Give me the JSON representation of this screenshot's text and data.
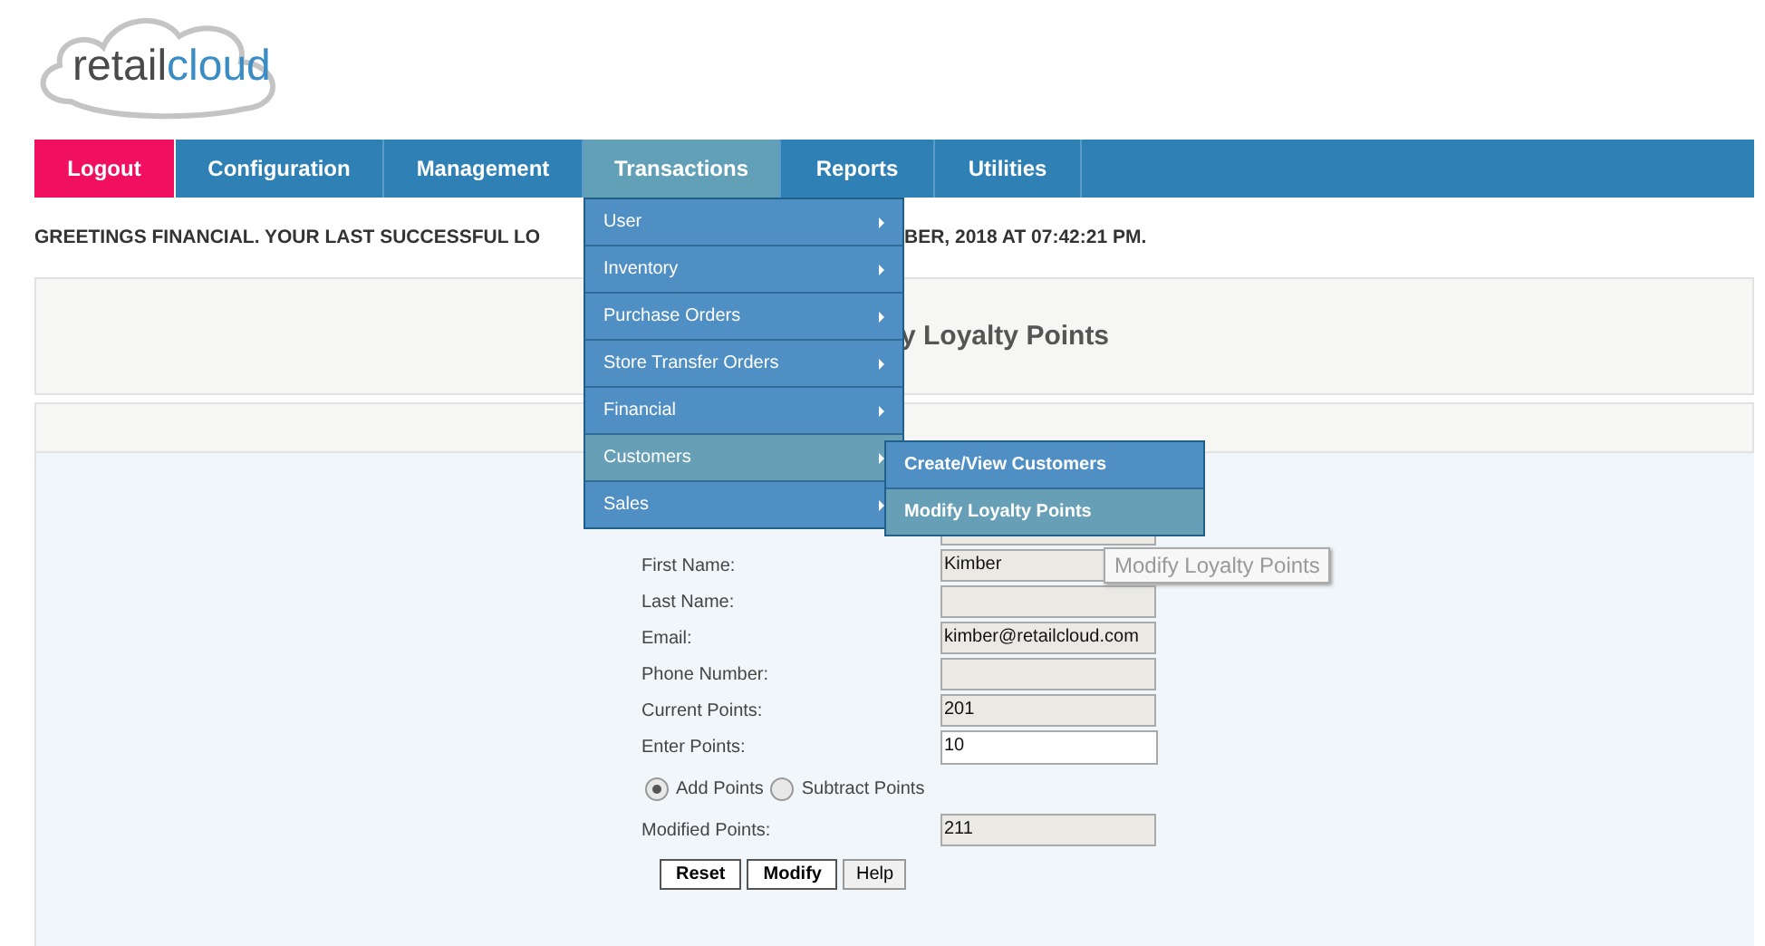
{
  "logo": {
    "part_1": "retail",
    "part_2": "cloud"
  },
  "nav": [
    {
      "label": "Logout",
      "kind": "logout",
      "selected": false
    },
    {
      "label": "Configuration",
      "kind": "menu",
      "selected": false
    },
    {
      "label": "Management",
      "kind": "menu",
      "selected": false
    },
    {
      "label": "Transactions",
      "kind": "menu",
      "selected": true
    },
    {
      "label": "Reports",
      "kind": "menu",
      "selected": false
    },
    {
      "label": "Utilities",
      "kind": "menu",
      "selected": false
    }
  ],
  "greeting": {
    "before_menu": "GREETINGS FINANCIAL. YOUR LAST SUCCESSFUL LO",
    "after_menu": "BER, 2018 AT 07:42:21 PM."
  },
  "page_title": "y Loyalty Points",
  "form": {
    "fields": [
      {
        "editable": false
      },
      {
        "label": "First Name:",
        "value": "Kimber",
        "editable": false
      },
      {
        "label": "Last Name:",
        "editable": false
      },
      {
        "label": "Email:",
        "value": "kimber@retailcloud.com",
        "editable": false
      },
      {
        "label": "Phone Number:",
        "editable": false
      },
      {
        "label": "Current Points:",
        "value": "201",
        "editable": false
      },
      {
        "label": "Enter Points:",
        "value": "10",
        "editable": true
      }
    ],
    "options": [
      {
        "label": "Add Points",
        "selected": true
      },
      {
        "label": "Subtract Points",
        "selected": false
      }
    ],
    "result": {
      "label": "Modified Points:",
      "value": "211"
    },
    "buttons": [
      "Reset",
      "Modify",
      "Help"
    ]
  },
  "menu": [
    {
      "label": "User",
      "selected": false
    },
    {
      "label": "Inventory",
      "selected": false
    },
    {
      "label": "Purchase Orders",
      "selected": false
    },
    {
      "label": "Store Transfer Orders",
      "selected": false
    },
    {
      "label": "Financial",
      "selected": false
    },
    {
      "label": "Customers",
      "selected": true
    },
    {
      "label": "Sales",
      "selected": false
    }
  ],
  "submenu": [
    {
      "label": "Create/View Customers",
      "selected": false
    },
    {
      "label": "Modify Loyalty Points",
      "selected": true
    }
  ],
  "tooltip": "Modify Loyalty Points"
}
